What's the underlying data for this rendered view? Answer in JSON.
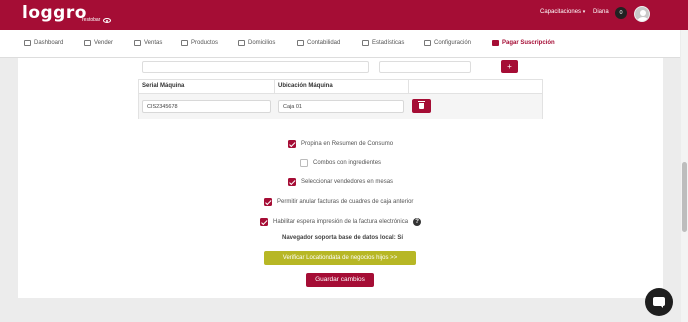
{
  "app": {
    "logo": "loggro",
    "logo_sub": "restobar"
  },
  "topbar": {
    "training_link": "Capacitaciones",
    "caret": "▾",
    "user_name": "Diana",
    "notifications": "0"
  },
  "nav": {
    "items": [
      {
        "label": "Dashboard"
      },
      {
        "label": "Vender"
      },
      {
        "label": "Ventas"
      },
      {
        "label": "Productos"
      },
      {
        "label": "Domicilios"
      },
      {
        "label": "Contabilidad"
      },
      {
        "label": "Estadísticas"
      },
      {
        "label": "Configuración"
      },
      {
        "label": "Pagar Suscripción"
      }
    ]
  },
  "form": {
    "add_button": "+",
    "table": {
      "columns": [
        "Serial Máquina",
        "Ubicación Máquina"
      ],
      "rows": [
        {
          "serial": "CIS2345678",
          "location": "Caja 01"
        }
      ]
    },
    "options": [
      {
        "label": "Propina en Resumen de Consumo",
        "checked": true
      },
      {
        "label": "Combos con ingredientes",
        "checked": false
      },
      {
        "label": "Seleccionar vendedores en mesas",
        "checked": true
      },
      {
        "label": "Permitir anular facturas de cuadres de caja anterior",
        "checked": true
      },
      {
        "label": "Habilitar espera impresión de la factura electrónica",
        "checked": true
      }
    ],
    "help_glyph": "?",
    "local_db_note": "Navegador soporta base de datos local: Sí",
    "verify_button": "Verificar Locationdata de negocios hijos >>",
    "save_button": "Guardar cambios"
  },
  "colors": {
    "brand": "#a50d35",
    "verify": "#b7b725"
  }
}
